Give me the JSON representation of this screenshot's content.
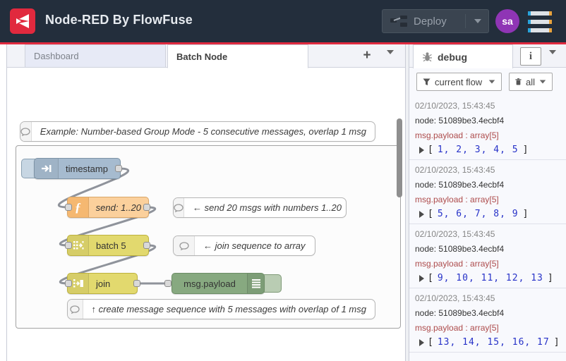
{
  "header": {
    "title": "Node-RED By FlowFuse",
    "deploy_label": "Deploy",
    "avatar_text": "sa"
  },
  "colors": {
    "header_bg": "#232e3c",
    "accent_red": "#e02a3f",
    "inject_node": "#a6bbcf",
    "function_node": "#fbd09c",
    "sequence_node": "#e2d96e",
    "debug_node": "#87a980",
    "avatar_purple": "#8f35b5",
    "debug_path_red": "#ad4b4b",
    "debug_value_blue": "#2732c8"
  },
  "tabs": {
    "dashboard": "Dashboard",
    "batch": "Batch Node",
    "add_label": "+"
  },
  "flow": {
    "comment_top": "Example: Number-based Group Mode - 5 consecutive messages, overlap 1 msg",
    "inject_label": "timestamp",
    "function_label": "send: 1..20",
    "comment_send": "← send 20 msgs with numbers 1..20",
    "batch_label": "batch 5",
    "comment_join": "← join sequence to array",
    "join_label": "join",
    "debug_label": "msg.payload",
    "comment_bottom": "↑ create message sequence with 5 messages with overlap of 1 msg"
  },
  "sidebar": {
    "tab_label": "debug",
    "info_label": "i",
    "filter_label": "current flow",
    "clear_label": "all",
    "array_open": "[",
    "array_close": "]",
    "messages": [
      {
        "timestamp": "02/10/2023, 15:43:45",
        "node": "node: 51089be3.4ecbf4",
        "path": "msg.payload : array[5]",
        "values": "1, 2, 3, 4, 5"
      },
      {
        "timestamp": "02/10/2023, 15:43:45",
        "node": "node: 51089be3.4ecbf4",
        "path": "msg.payload : array[5]",
        "values": "5, 6, 7, 8, 9"
      },
      {
        "timestamp": "02/10/2023, 15:43:45",
        "node": "node: 51089be3.4ecbf4",
        "path": "msg.payload : array[5]",
        "values": "9, 10, 11, 12, 13"
      },
      {
        "timestamp": "02/10/2023, 15:43:45",
        "node": "node: 51089be3.4ecbf4",
        "path": "msg.payload : array[5]",
        "values": "13, 14, 15, 16, 17"
      }
    ]
  }
}
